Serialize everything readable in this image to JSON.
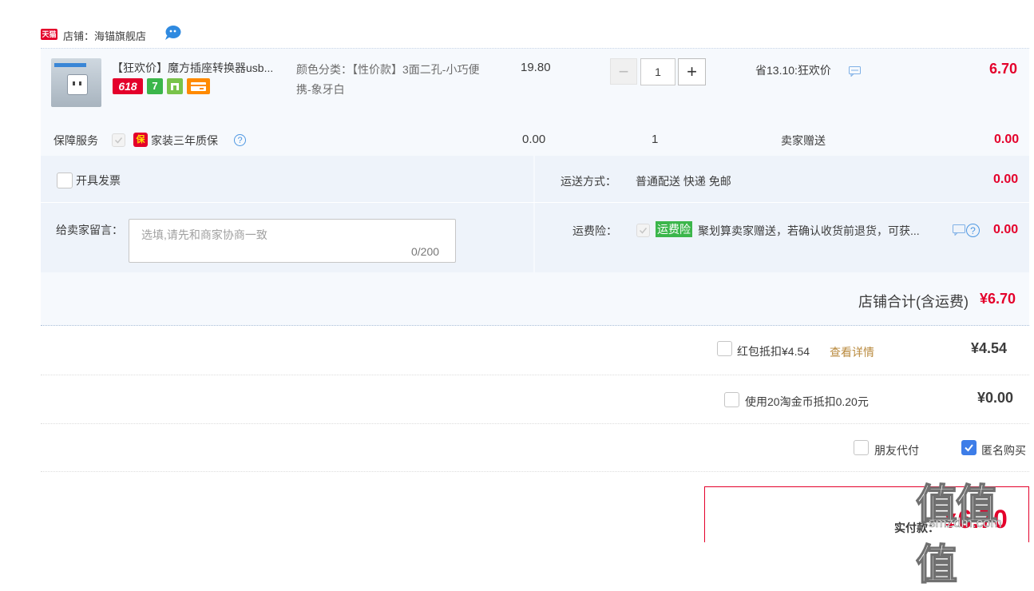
{
  "shop": {
    "badge": "天猫",
    "name": "店铺：海锚旗舰店",
    "chat_icon": "wangwang-chat-icon"
  },
  "item": {
    "title": "【狂欢价】魔方插座转换器usb...",
    "tags": [
      "618",
      "7"
    ],
    "sku_label": "颜色分类：【性价款】3面二孔-小巧便携-象牙白",
    "price": "19.80",
    "qty_minus": "−",
    "qty": "1",
    "qty_plus": "+",
    "saving": "省13.10:狂欢价",
    "total": "6.70"
  },
  "service": {
    "label": "保障服务",
    "icon_text": "保",
    "name": "家装三年质保",
    "help": "?",
    "price": "0.00",
    "qty": "1",
    "gift": "卖家赠送",
    "total": "0.00"
  },
  "invoice": {
    "label": "开具发票"
  },
  "shipping": {
    "label": "运送方式：",
    "value": "普通配送 快递 免邮",
    "total": "0.00"
  },
  "message": {
    "label": "给卖家留言：",
    "placeholder": "选填,请先和商家协商一致",
    "count": "0/200"
  },
  "insurance": {
    "label": "运费险：",
    "tag": "运费险",
    "desc": "聚划算卖家赠送，若确认收货前退货，可获...",
    "total": "0.00"
  },
  "shop_total": {
    "label": "店铺合计(含运费)",
    "value": "¥6.70"
  },
  "coupon": {
    "label": "红包抵扣¥4.54",
    "link": "查看详情",
    "value": "¥4.54"
  },
  "coins": {
    "label": "使用20淘金币抵扣0.20元",
    "value": "¥0.00"
  },
  "options": {
    "friend_pay": "朋友代付",
    "anonymous": "匿名购买",
    "anonymous_checked": true
  },
  "payment": {
    "label": "实付款：",
    "currency": "¥",
    "amount": "6.70"
  },
  "watermark": {
    "logo": "值值值",
    "url": "smzdm.com"
  },
  "colors": {
    "accent": "#e4002b",
    "checkbox_on": "#3d7de8",
    "insurance_tag": "#3bb64b"
  }
}
